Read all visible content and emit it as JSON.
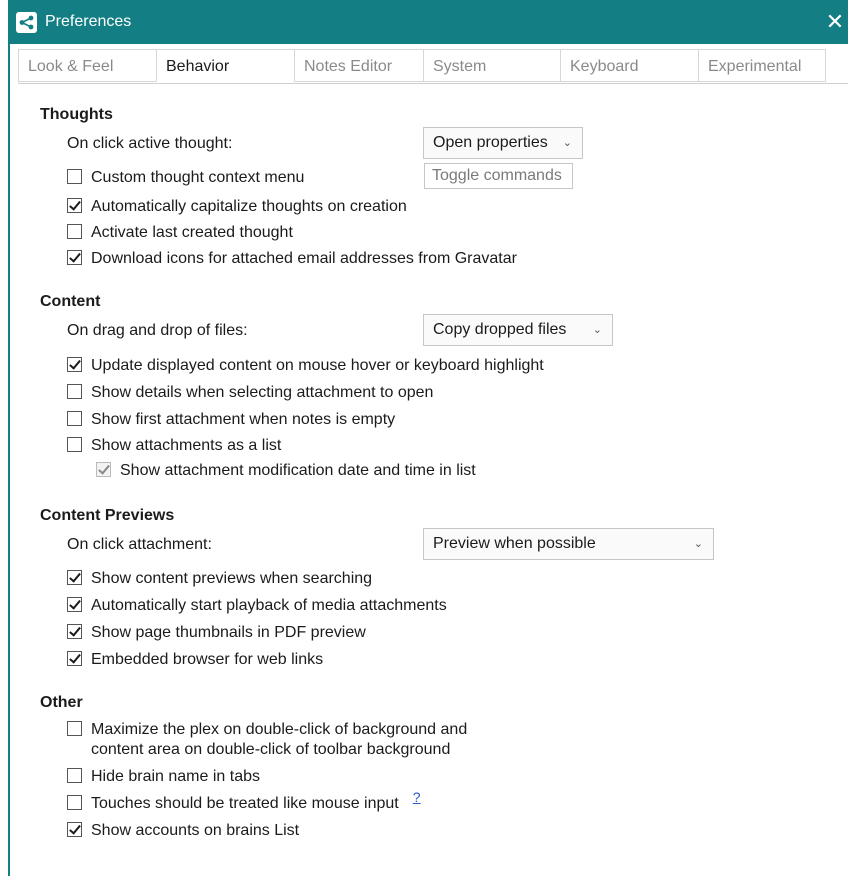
{
  "window": {
    "title": "Preferences",
    "close_glyph": "✕"
  },
  "tabs": [
    {
      "label": "Look & Feel",
      "active": false
    },
    {
      "label": "Behavior",
      "active": true
    },
    {
      "label": "Notes Editor",
      "active": false
    },
    {
      "label": "System",
      "active": false
    },
    {
      "label": "Keyboard",
      "active": false
    },
    {
      "label": "Experimental",
      "active": false
    }
  ],
  "thoughts": {
    "title": "Thoughts",
    "on_click_label": "On click active thought:",
    "on_click_value": "Open properties",
    "custom_menu_label": "Custom thought context menu",
    "custom_menu_checked": false,
    "toggle_button": "Toggle commands",
    "capitalize_label": "Automatically capitalize thoughts on creation",
    "capitalize_checked": true,
    "activate_label": "Activate last created thought",
    "activate_checked": false,
    "gravatar_label": "Download icons for attached email addresses from Gravatar",
    "gravatar_checked": true
  },
  "content": {
    "title": "Content",
    "drag_label": "On drag and drop of files:",
    "drag_value": "Copy dropped files",
    "update_label": "Update displayed content on mouse hover or keyboard highlight",
    "update_checked": true,
    "details_label": "Show details when selecting attachment to open",
    "details_checked": false,
    "first_label": "Show first attachment when notes is empty",
    "first_checked": false,
    "list_label": "Show attachments as a list",
    "list_checked": false,
    "moddate_label": "Show attachment modification date and time in list",
    "moddate_checked": true
  },
  "previews": {
    "title": "Content Previews",
    "click_label": "On click attachment:",
    "click_value": "Preview when possible",
    "searching_label": "Show content previews when searching",
    "searching_checked": true,
    "playback_label": "Automatically start playback of media attachments",
    "playback_checked": true,
    "thumbs_label": "Show page thumbnails in PDF preview",
    "thumbs_checked": true,
    "browser_label": "Embedded browser for web links",
    "browser_checked": true
  },
  "other": {
    "title": "Other",
    "maximize_line1": "Maximize the plex on double-click of background and",
    "maximize_line2": "content area on double-click of toolbar background",
    "maximize_checked": false,
    "hide_label": "Hide brain name in tabs",
    "hide_checked": false,
    "touch_label": "Touches should be treated like mouse input",
    "touch_checked": false,
    "help_link": "?",
    "accounts_label": "Show accounts on brains List",
    "accounts_checked": true
  },
  "icons": {
    "app": "plex-app-icon",
    "close": "close-icon",
    "dropdown": "chevron-down-icon",
    "check": "checkmark-icon"
  },
  "colors": {
    "titlebar": "#137e84",
    "link": "#2a55c9"
  }
}
